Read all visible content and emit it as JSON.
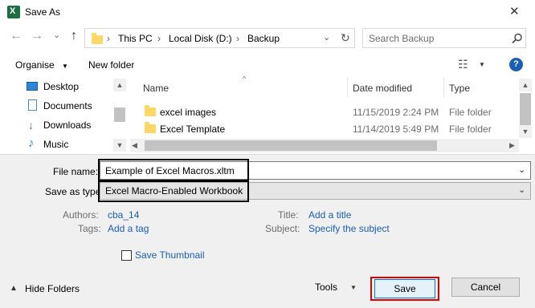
{
  "window": {
    "title": "Save As",
    "close_glyph": "✕",
    "app_icon": "excel-icon",
    "app_icon_letter": "X"
  },
  "nav": {
    "back_glyph": "←",
    "forward_glyph": "→",
    "recent_glyph": "⌄",
    "up_glyph": "↑",
    "breadcrumb": [
      "This PC",
      "Local Disk (D:)",
      "Backup"
    ],
    "separator": "›",
    "dropdown_glyph": "⌄",
    "refresh_glyph": "↻",
    "search_placeholder": "Search Backup",
    "search_icon": "search-icon"
  },
  "toolbar": {
    "organise": "Organise",
    "new_folder": "New folder",
    "view_glyph": "☷",
    "help_glyph": "?"
  },
  "sidebar": {
    "items": [
      {
        "label": "Desktop",
        "icon": "desktop-icon"
      },
      {
        "label": "Documents",
        "icon": "documents-icon"
      },
      {
        "label": "Downloads",
        "icon": "downloads-icon"
      },
      {
        "label": "Music",
        "icon": "music-icon"
      }
    ]
  },
  "file_list": {
    "columns": [
      "Name",
      "Date modified",
      "Type"
    ],
    "rows": [
      {
        "name": "excel images",
        "date": "11/15/2019 2:24 PM",
        "type": "File folder"
      },
      {
        "name": "Excel Template",
        "date": "11/14/2019 5:49 PM",
        "type": "File folder"
      }
    ]
  },
  "form": {
    "file_name_label": "File name:",
    "file_name_value": "Example of Excel Macros.xltm",
    "save_as_type_label": "Save as type:",
    "save_as_type_value": "Excel Macro-Enabled Workbook",
    "authors_label": "Authors:",
    "authors_value": "cba_14",
    "tags_label": "Tags:",
    "tags_value": "Add a tag",
    "title_label": "Title:",
    "title_value": "Add a title",
    "subject_label": "Subject:",
    "subject_value": "Specify the subject",
    "thumbnail_label": "Save Thumbnail",
    "thumbnail_checked": false
  },
  "footer": {
    "hide_folders": "Hide Folders",
    "tools": "Tools",
    "save": "Save",
    "cancel": "Cancel"
  },
  "colors": {
    "highlight_box": "#000000",
    "save_highlight": "#e00000",
    "link": "#1a5fb4",
    "accent_help": "#1a5fb4"
  }
}
